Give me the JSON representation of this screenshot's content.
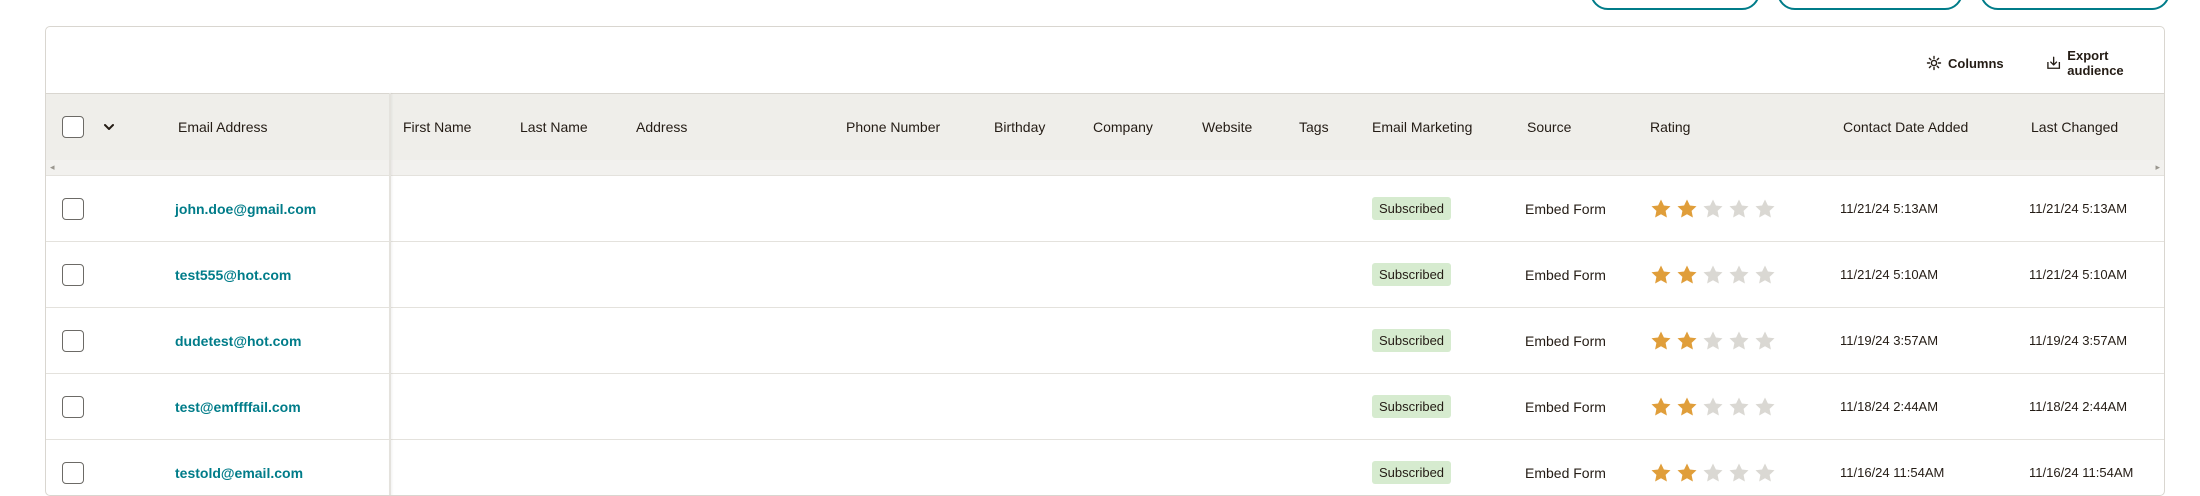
{
  "toolbar": {
    "columns_label": "Columns",
    "export_label": "Export audience"
  },
  "table": {
    "headers": {
      "email": "Email Address",
      "first_name": "First Name",
      "last_name": "Last Name",
      "address": "Address",
      "phone": "Phone Number",
      "birthday": "Birthday",
      "company": "Company",
      "website": "Website",
      "tags": "Tags",
      "email_marketing": "Email Marketing",
      "source": "Source",
      "rating": "Rating",
      "date_added": "Contact Date Added",
      "last_changed": "Last Changed"
    },
    "rows": [
      {
        "email": "john.doe@gmail.com",
        "status": "Subscribed",
        "source": "Embed Form",
        "rating": 2,
        "date_added": "11/21/24 5:13AM",
        "last_changed": "11/21/24 5:13AM"
      },
      {
        "email": "test555@hot.com",
        "status": "Subscribed",
        "source": "Embed Form",
        "rating": 2,
        "date_added": "11/21/24 5:10AM",
        "last_changed": "11/21/24 5:10AM"
      },
      {
        "email": "dudetest@hot.com",
        "status": "Subscribed",
        "source": "Embed Form",
        "rating": 2,
        "date_added": "11/19/24 3:57AM",
        "last_changed": "11/19/24 3:57AM"
      },
      {
        "email": "test@emffffail.com",
        "status": "Subscribed",
        "source": "Embed Form",
        "rating": 2,
        "date_added": "11/18/24 2:44AM",
        "last_changed": "11/18/24 2:44AM"
      },
      {
        "email": "testold@email.com",
        "status": "Subscribed",
        "source": "Embed Form",
        "rating": 2,
        "date_added": "11/16/24 11:54AM",
        "last_changed": "11/16/24 11:54AM"
      }
    ],
    "rating_max": 5
  },
  "colors": {
    "accent": "#007c89",
    "star_filled": "#e09e3a",
    "star_empty": "#dad8d3",
    "badge_bg": "#d6ebcf"
  }
}
